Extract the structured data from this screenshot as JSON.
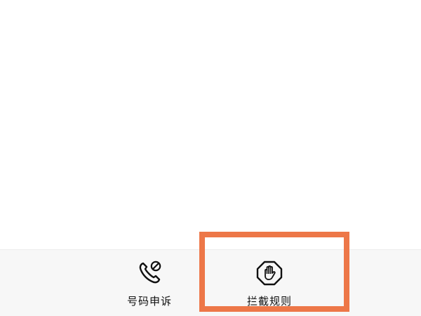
{
  "bottom_nav": {
    "items": [
      {
        "label": "号码申诉",
        "icon": "phone-blocked-icon"
      },
      {
        "label": "拦截规则",
        "icon": "stop-hand-icon"
      }
    ]
  },
  "highlight": {
    "color": "#ed7748",
    "target": "拦截规则"
  }
}
